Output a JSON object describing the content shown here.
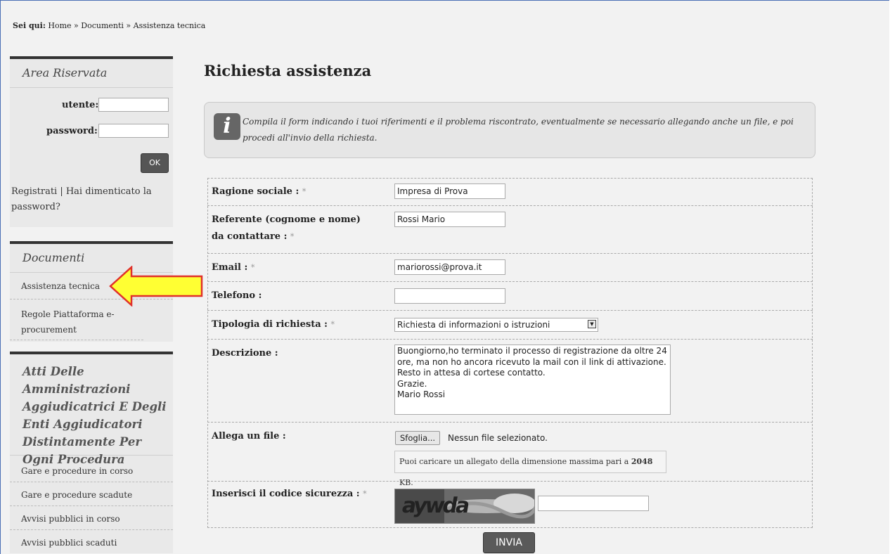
{
  "breadcrumb": {
    "prefix": "Sei qui:",
    "path": "Home » Documenti » Assistenza tecnica"
  },
  "sidebar": {
    "login": {
      "title": "Area Riservata",
      "user_label": "utente:",
      "password_label": "password:",
      "ok_label": "OK",
      "links_text": "Registrati | Hai dimenticato la password?"
    },
    "documenti": {
      "title": "Documenti",
      "items": [
        {
          "label": "Assistenza tecnica"
        },
        {
          "label": "Regole Piattaforma e-procurement"
        }
      ]
    },
    "atti": {
      "title": "Atti Delle Amministrazioni Aggiudicatrici E Degli Enti Aggiudicatori Distintamente Per Ogni Procedura",
      "items": [
        {
          "label": "Gare e procedure in corso"
        },
        {
          "label": "Gare e procedure scadute"
        },
        {
          "label": "Avvisi pubblici in corso"
        },
        {
          "label": "Avvisi pubblici scaduti"
        }
      ]
    }
  },
  "main": {
    "title": "Richiesta assistenza",
    "info": "Compila il form indicando i tuoi riferimenti e il problema riscontrato, eventualmente se necessario allegando anche un file, e poi procedi all'invio della richiesta.",
    "form": {
      "ragione_sociale": {
        "label": "Ragione sociale :",
        "value": "Impresa di Prova"
      },
      "referente": {
        "label": "Referente (cognome e nome) da contattare :",
        "value": "Rossi Mario"
      },
      "email": {
        "label": "Email :",
        "value": "mariorossi@prova.it"
      },
      "telefono": {
        "label": "Telefono :",
        "value": ""
      },
      "tipologia": {
        "label": "Tipologia di richiesta :",
        "value": "Richiesta di informazioni o istruzioni"
      },
      "descrizione": {
        "label": "Descrizione :",
        "value": "Buongiorno,ho terminato il processo di registrazione da oltre 24 ore, ma non ho ancora ricevuto la mail con il link di attivazione.\nResto in attesa di cortese contatto.\nGrazie.\nMario Rossi"
      },
      "allegato": {
        "label": "Allega un file :",
        "browse_label": "Sfoglia...",
        "no_file_text": "Nessun file selezionato.",
        "hint_prefix": "Puoi caricare un allegato della dimensione massima pari a",
        "hint_size": "2048",
        "hint_unit": "KB."
      },
      "captcha": {
        "label": "Inserisci il codice sicurezza :",
        "image_text": "aywda",
        "value": ""
      },
      "required_mark": "*",
      "submit_label": "INVIA"
    }
  },
  "colors": {
    "frame_border": "#4a6fb5",
    "arrow_fill": "#ffff33",
    "arrow_stroke": "#e0302a"
  }
}
